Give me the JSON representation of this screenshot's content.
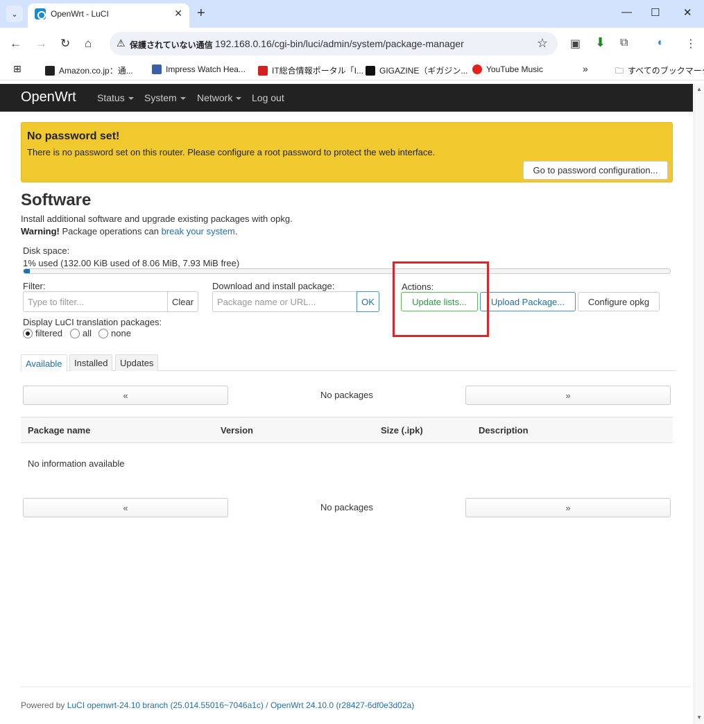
{
  "browser": {
    "tab_title": "OpenWrt - LuCI",
    "insecure_label": "保護されていない通信",
    "url": "192.168.0.16/cgi-bin/luci/admin/system/package-manager",
    "bookmarks": [
      {
        "label": "Amazon.co.jp：通...",
        "color": "#222222"
      },
      {
        "label": "Impress Watch Hea...",
        "color": "#3a5ea8"
      },
      {
        "label": "IT総合情報ポータル「I...",
        "color": "#d61f1f"
      },
      {
        "label": "GIGAZINE（ギガジン...",
        "color": "#111111"
      },
      {
        "label": "YouTube Music",
        "color": "#e62117"
      }
    ],
    "all_bookmarks": "すべてのブックマーク"
  },
  "nav": {
    "brand": "OpenWrt",
    "items": [
      "Status",
      "System",
      "Network",
      "Log out"
    ]
  },
  "alert": {
    "title": "No password set!",
    "text": "There is no password set on this router. Please configure a root password to protect the web interface.",
    "button": "Go to password configuration..."
  },
  "page": {
    "title": "Software",
    "intro": "Install additional software and upgrade existing packages with opkg.",
    "warning_bold": "Warning!",
    "warning_text": " Package operations can ",
    "warning_link": "break your system",
    "warning_end": "."
  },
  "disk": {
    "label": "Disk space:",
    "text": "1% used (132.00 KiB used of 8.06 MiB, 7.93 MiB free)",
    "used_fraction": 0.01
  },
  "filter": {
    "label": "Filter:",
    "placeholder": "Type to filter...",
    "clear": "Clear"
  },
  "download": {
    "label": "Download and install package:",
    "placeholder": "Package name or URL...",
    "ok": "OK"
  },
  "actions": {
    "label": "Actions:",
    "update": "Update lists...",
    "upload": "Upload Package...",
    "configure": "Configure opkg"
  },
  "translation": {
    "label": "Display LuCI translation packages:",
    "options": [
      "filtered",
      "all",
      "none"
    ],
    "selected": "filtered"
  },
  "tabs": [
    "Available",
    "Installed",
    "Updates"
  ],
  "pager": {
    "prev": "«",
    "next": "»",
    "status": "No packages"
  },
  "table": {
    "headers": [
      "Package name",
      "Version",
      "Size (.ipk)",
      "Description"
    ],
    "empty": "No information available"
  },
  "footer": {
    "prefix": "Powered by ",
    "luci": "LuCI openwrt-24.10 branch (25.014.55016~7046a1c)",
    "sep": " / ",
    "openwrt": "OpenWrt 24.10.0 (r28427-6df0e3d02a)"
  }
}
